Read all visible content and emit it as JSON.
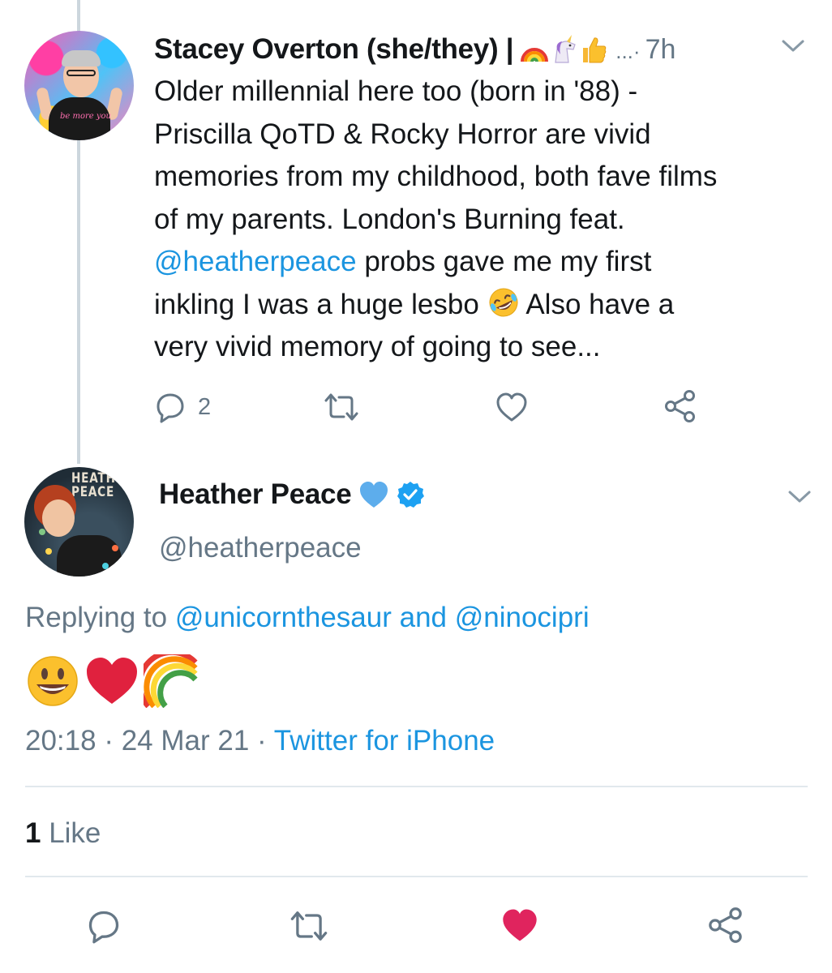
{
  "thread_tweet": {
    "author_name": "Stacey Overton (she/they) |",
    "name_emojis": [
      "rainbow-emoji",
      "unicorn-emoji",
      "thumbs-up-emoji"
    ],
    "truncation": "...·",
    "time": "7h",
    "body": {
      "line1": "Older millennial here too (born in '88) -",
      "line2": "Priscilla QoTD & Rocky Horror are vivid",
      "line3": "memories from my childhood, both fave films",
      "line4": "of my parents. London's Burning feat.",
      "mention": "@heatherpeace",
      "line5_rest": " probs gave me my first",
      "line6_a": "inkling I was a huge lesbo ",
      "line6_b": " Also have a",
      "line7": "very vivid memory of going to see..."
    },
    "shirt_text": "be more you",
    "reply_count": "2"
  },
  "main_tweet": {
    "author_name": "Heather Peace",
    "handle": "@heatherpeace",
    "avatar_text": "HEATHER PEACE",
    "replying_prefix": "Replying to ",
    "replying_to": "@unicornthesaur and @ninocipri",
    "emojis": [
      "smiley-emoji",
      "red-heart-emoji",
      "rainbow-emoji"
    ],
    "time": "20:18",
    "date": "24 Mar 21",
    "separator": "·",
    "source": "Twitter for iPhone",
    "like_count": "1",
    "like_label": " Like"
  },
  "colors": {
    "text": "#14171a",
    "secondary": "#657786",
    "link": "#1b95e0",
    "like_red": "#e0245e",
    "verified": "#1da1f2",
    "blue_heart": "#5dadec"
  }
}
